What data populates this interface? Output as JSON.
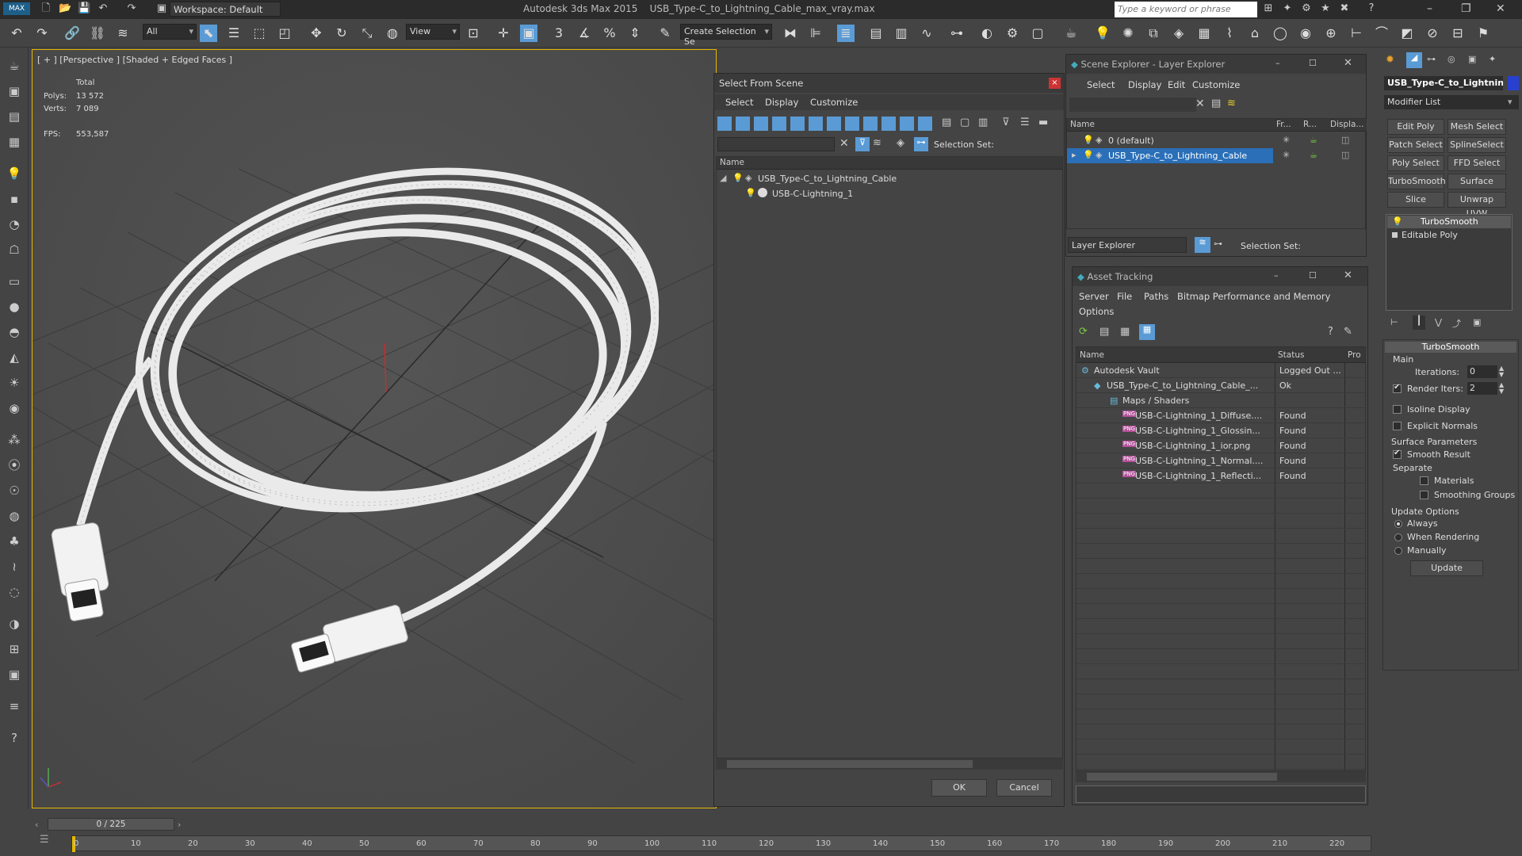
{
  "titlebar": {
    "workspace": "Workspace: Default",
    "app_name": "Autodesk 3ds Max  2015",
    "file_name": "USB_Type-C_to_Lightning_Cable_max_vray.max",
    "search_placeholder": "Type a keyword or phrase"
  },
  "toolbar": {
    "filter_value": "All",
    "ref_coord_value": "View",
    "selection_set_value": "Create Selection Se"
  },
  "viewport": {
    "label": "[ + ] [Perspective ] [Shaded + Edged Faces ]",
    "stats": {
      "total_label": "Total",
      "polys_label": "Polys:",
      "polys_value": "13 572",
      "verts_label": "Verts:",
      "verts_value": "7 089",
      "fps_label": "FPS:",
      "fps_value": "553,587"
    }
  },
  "select_from_scene": {
    "title": "Select From Scene",
    "menus": [
      "Select",
      "Display",
      "Customize"
    ],
    "selection_set_label": "Selection Set:",
    "column_name": "Name",
    "tree": [
      {
        "label": "USB_Type-C_to_Lightning_Cable"
      },
      {
        "label": "USB-C-Lightning_1"
      }
    ],
    "ok_label": "OK",
    "cancel_label": "Cancel"
  },
  "scene_explorer": {
    "title": "Scene Explorer - Layer Explorer",
    "menus": [
      "Select",
      "Display",
      "Edit",
      "Customize"
    ],
    "columns": [
      "Name",
      "Fr...",
      "R...",
      "Displa..."
    ],
    "layers": [
      {
        "label": "0 (default)"
      },
      {
        "label": "USB_Type-C_to_Lightning_Cable"
      }
    ],
    "footer_dropdown": "Layer Explorer",
    "selection_set_label": "Selection Set:"
  },
  "asset_tracking": {
    "title": "Asset Tracking",
    "menus": [
      "Server",
      "File",
      "Paths",
      "Bitmap Performance and Memory",
      "Options"
    ],
    "columns": [
      "Name",
      "Status",
      "Pro"
    ],
    "rows": [
      {
        "name": "Autodesk Vault",
        "status": "Logged Out ..."
      },
      {
        "name": "USB_Type-C_to_Lightning_Cable_...",
        "status": "Ok"
      },
      {
        "name": "Maps / Shaders",
        "status": ""
      },
      {
        "name": "USB-C-Lightning_1_Diffuse....",
        "status": "Found"
      },
      {
        "name": "USB-C-Lightning_1_Glossin...",
        "status": "Found"
      },
      {
        "name": "USB-C-Lightning_1_ior.png",
        "status": "Found"
      },
      {
        "name": "USB-C-Lightning_1_Normal....",
        "status": "Found"
      },
      {
        "name": "USB-C-Lightning_1_Reflecti...",
        "status": "Found"
      }
    ]
  },
  "command_panel": {
    "object_name": "USB_Type-C_to_Lightnin",
    "modifier_list": "Modifier List",
    "buttons": [
      "Edit Poly",
      "Mesh Select",
      "Patch Select",
      "SplineSelect",
      "Poly Select",
      "FFD Select",
      "TurboSmooth",
      "Surface Select",
      "Slice",
      "Unwrap UVW"
    ],
    "stack": [
      "TurboSmooth",
      "Editable Poly"
    ],
    "rollout_title": "TurboSmooth",
    "main_label": "Main",
    "iterations_label": "Iterations:",
    "iterations_value": "0",
    "render_iters_label": "Render Iters:",
    "render_iters_value": "2",
    "isoline_label": "Isoline Display",
    "explicit_normals_label": "Explicit Normals",
    "surface_params_label": "Surface Parameters",
    "smooth_result_label": "Smooth Result",
    "separate_label": "Separate",
    "materials_label": "Materials",
    "smoothing_groups_label": "Smoothing Groups",
    "update_options_label": "Update Options",
    "always_label": "Always",
    "when_rendering_label": "When Rendering",
    "manually_label": "Manually",
    "update_button": "Update"
  },
  "timeline": {
    "frame_counter": "0 / 225",
    "ticks": [
      "0",
      "10",
      "20",
      "30",
      "40",
      "50",
      "60",
      "70",
      "80",
      "90",
      "100",
      "110",
      "120",
      "130",
      "140",
      "150",
      "160",
      "170",
      "180",
      "190",
      "200",
      "210",
      "220"
    ]
  }
}
